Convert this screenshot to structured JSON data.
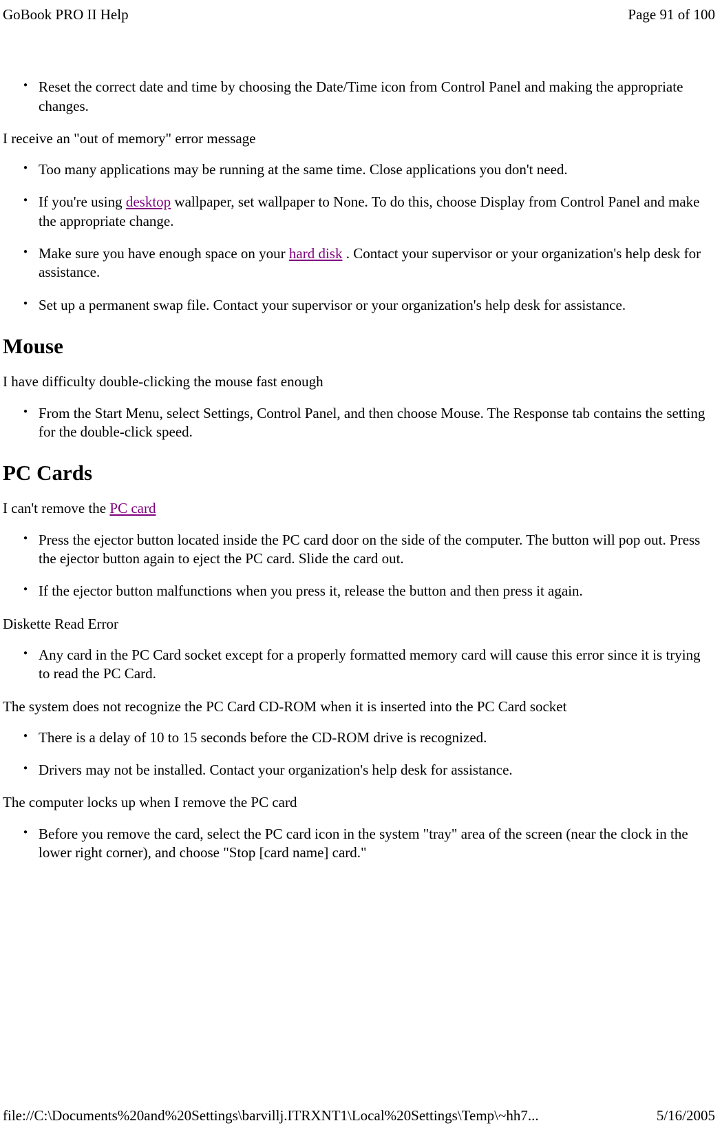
{
  "header": {
    "title": "GoBook PRO II Help",
    "page": "Page 91 of 100"
  },
  "sections": [
    {
      "type": "list",
      "items": [
        {
          "parts": [
            {
              "text": "Reset the correct date and time by choosing the Date/Time icon from Control Panel and making the appropriate changes."
            }
          ]
        }
      ]
    },
    {
      "type": "para",
      "text": "I receive an \"out of memory\" error message"
    },
    {
      "type": "list",
      "items": [
        {
          "parts": [
            {
              "text": "Too many applications may be running at the same time. Close applications you don't need."
            }
          ]
        },
        {
          "parts": [
            {
              "text": "If you're using "
            },
            {
              "text": "desktop",
              "link": true
            },
            {
              "text": " wallpaper, set wallpaper to None. To do this, choose Display from Control Panel and make the appropriate change."
            }
          ]
        },
        {
          "parts": [
            {
              "text": "Make sure you have enough space on your "
            },
            {
              "text": "hard disk",
              "link": true
            },
            {
              "text": " . Contact your supervisor or your organization's help desk for assistance."
            }
          ]
        },
        {
          "parts": [
            {
              "text": "Set up a permanent swap file. Contact your supervisor or your organization's help desk for assistance."
            }
          ]
        }
      ]
    },
    {
      "type": "h2",
      "text": "Mouse"
    },
    {
      "type": "para",
      "text": "I have difficulty double-clicking the mouse fast enough"
    },
    {
      "type": "list",
      "items": [
        {
          "parts": [
            {
              "text": "From the Start Menu, select Settings, Control Panel, and then choose Mouse.  The Response tab contains the setting for the double-click speed."
            }
          ]
        }
      ]
    },
    {
      "type": "h2",
      "text": "PC Cards"
    },
    {
      "type": "para",
      "parts": [
        {
          "text": "I can't remove the "
        },
        {
          "text": "PC card",
          "link": true
        }
      ]
    },
    {
      "type": "list",
      "items": [
        {
          "parts": [
            {
              "text": "Press the ejector button located inside the PC card door on the side of the computer. The button will pop out. Press the ejector button again to eject the PC card.  Slide the card out."
            }
          ]
        },
        {
          "parts": [
            {
              "text": "If the ejector button malfunctions when you press it, release the button and then press it again."
            }
          ]
        }
      ]
    },
    {
      "type": "para",
      "text": "Diskette Read Error"
    },
    {
      "type": "list",
      "items": [
        {
          "parts": [
            {
              "text": "Any card in the PC Card socket except for a properly formatted memory card will cause this error since it is trying to read the PC Card."
            }
          ]
        }
      ]
    },
    {
      "type": "para",
      "text": "The system does not recognize the PC Card CD-ROM when it is inserted into the PC Card socket"
    },
    {
      "type": "list",
      "items": [
        {
          "parts": [
            {
              "text": "There is a delay of 10 to 15 seconds before the CD-ROM drive is recognized."
            }
          ]
        },
        {
          "parts": [
            {
              "text": "Drivers may not be installed. Contact your organization's help desk for assistance."
            }
          ]
        }
      ]
    },
    {
      "type": "para",
      "text": "The computer locks up when I remove the PC card"
    },
    {
      "type": "list",
      "items": [
        {
          "parts": [
            {
              "text": "Before you remove the card, select the PC card icon in the system \"tray\" area of the screen (near the clock in the lower right corner), and choose \"Stop [card name] card.\""
            }
          ]
        }
      ]
    }
  ],
  "footer": {
    "path": "file://C:\\Documents%20and%20Settings\\barvillj.ITRXNT1\\Local%20Settings\\Temp\\~hh7...",
    "date": "5/16/2005"
  }
}
